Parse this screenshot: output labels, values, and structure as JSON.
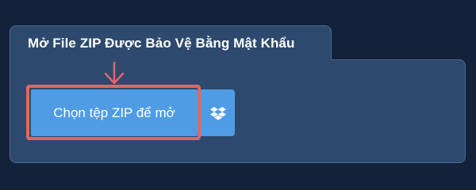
{
  "panel": {
    "title": "Mở File ZIP Được Bảo Vệ Bằng Mật Khẩu"
  },
  "upload": {
    "choose_label": "Chọn tệp ZIP để mở",
    "dropbox_icon": "dropbox-icon"
  },
  "colors": {
    "background": "#13213a",
    "panel": "#2d4a6e",
    "button": "#4f9ce4",
    "highlight": "#e06666"
  }
}
